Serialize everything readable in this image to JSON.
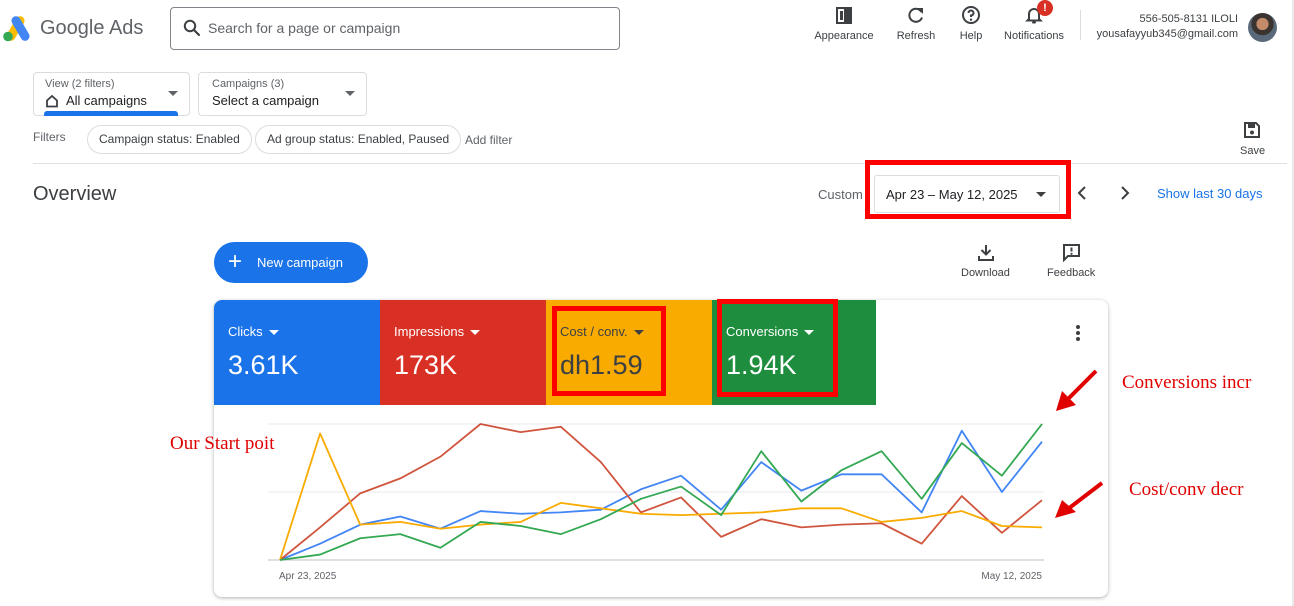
{
  "app": {
    "name": "Google Ads"
  },
  "search": {
    "placeholder": "Search for a page or campaign"
  },
  "toolbar": {
    "appearance_label": "Appearance",
    "refresh_label": "Refresh",
    "help_label": "Help",
    "notifications_label": "Notifications",
    "notifications_badge": "!"
  },
  "account": {
    "number": "556-505-8131 ILOLI",
    "email": "yousafayyub345@gmail.com"
  },
  "view_selector": {
    "caption": "View (2 filters)",
    "value": "All campaigns"
  },
  "campaign_selector": {
    "caption": "Campaigns (3)",
    "value": "Select a campaign"
  },
  "filters": {
    "label": "Filters",
    "chips": [
      "Campaign status: Enabled",
      "Ad group status: Enabled, Paused"
    ],
    "add_filter": "Add filter"
  },
  "save_label": "Save",
  "overview": {
    "title": "Overview",
    "range_type": "Custom",
    "date_range": "Apr 23 – May 12, 2025",
    "show_last": "Show last 30 days"
  },
  "actions": {
    "new_campaign": "New campaign",
    "download": "Download",
    "feedback": "Feedback"
  },
  "metrics": [
    {
      "name": "Clicks",
      "value": "3.61K",
      "color": "#1a73e8"
    },
    {
      "name": "Impressions",
      "value": "173K",
      "color": "#d93025"
    },
    {
      "name": "Cost / conv.",
      "value": "dh1.59",
      "color": "#f9ab00"
    },
    {
      "name": "Conversions",
      "value": "1.94K",
      "color": "#1e8e3e"
    }
  ],
  "annotations": {
    "start": "Our Start poit",
    "conversions": "Conversions incr",
    "cost": "Cost/conv decr",
    "color": "#e00000"
  },
  "chart_data": {
    "type": "line",
    "x": [
      "Apr 23, 2025",
      "Apr 24",
      "Apr 25",
      "Apr 26",
      "Apr 27",
      "Apr 28",
      "Apr 29",
      "Apr 30",
      "May 1",
      "May 2",
      "May 3",
      "May 4",
      "May 5",
      "May 6",
      "May 7",
      "May 8",
      "May 9",
      "May 10",
      "May 11",
      "May 12, 2025"
    ],
    "tick_labels": [
      "Apr 23, 2025",
      "May 12, 2025"
    ],
    "ylim": [
      0,
      100
    ],
    "grid": true,
    "series": [
      {
        "name": "Clicks",
        "color": "#4285f4",
        "values": [
          0,
          12,
          26,
          32,
          23,
          36,
          34,
          35,
          37,
          52,
          62,
          37,
          72,
          51,
          63,
          63,
          35,
          95,
          50,
          87
        ]
      },
      {
        "name": "Impressions",
        "color": "#d0553e",
        "values": [
          0,
          24,
          49,
          60,
          76,
          100,
          94,
          98,
          72,
          35,
          46,
          17,
          30,
          24,
          26,
          27,
          12,
          47,
          20,
          44
        ]
      },
      {
        "name": "Cost / conv.",
        "color": "#f9ab00",
        "values": [
          0,
          93,
          26,
          28,
          23,
          26,
          28,
          42,
          38,
          34,
          33,
          34,
          35,
          38,
          38,
          28,
          31,
          36,
          25,
          24
        ]
      },
      {
        "name": "Conversions",
        "color": "#34a853",
        "values": [
          0,
          4,
          16,
          19,
          9,
          28,
          25,
          19,
          30,
          45,
          54,
          33,
          80,
          43,
          66,
          80,
          45,
          86,
          62,
          100
        ]
      }
    ]
  }
}
